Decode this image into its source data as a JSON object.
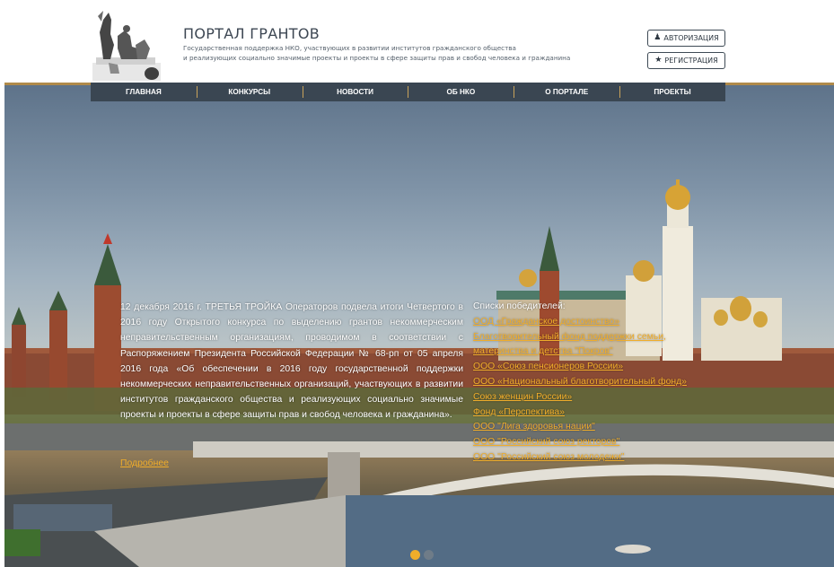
{
  "header": {
    "title": "ПОРТАЛ ГРАНТОВ",
    "subtitle_line1": "Государственная поддержка НКО, участвующих в развитии институтов гражданского общества",
    "subtitle_line2": "и реализующих социально значимые проекты и проекты в сфере защиты прав и свобод человека и гражданина",
    "login_label": "АВТОРИЗАЦИЯ",
    "register_label": "РЕГИСТРАЦИЯ",
    "login_icon": "user-icon",
    "register_icon": "star-icon"
  },
  "nav": {
    "items": [
      "ГЛАВНАЯ",
      "КОНКУРСЫ",
      "НОВОСТИ",
      "ОБ НКО",
      "О ПОРТАЛЕ",
      "ПРОЕКТЫ"
    ]
  },
  "slide": {
    "news_text": "12 декабря 2016 г. ТРЕТЬЯ ТРОЙКА Операторов подвела итоги Четвертого в 2016 году Открытого конкурса по выделению грантов некоммерческим неправительственным организациям, проводимом в соответствии с Распоряжением Президента Российской Федерации № 68-рп от 05 апреля 2016 года «Об обеспечении в 2016 году государственной поддержки некоммерческих неправительственных организаций, участвующих в развитии институтов гражданского общества и реализующих социально значимые проекты и проекты в сфере защиты прав и свобод человека и гражданина».",
    "more_label": "Подробнее",
    "winners_title": "Списки победителей:",
    "winners": [
      "ООД «Гражданское достоинство»",
      "Благотворительный фонд поддержки семьи, материнства и детства \"Покров\"",
      "ООО «Союз пенсионеров России»",
      "ООО «Национальный благотворительный фонд»",
      "Союз женщин России»",
      "Фонд «Перспектива»",
      "ООО \"Лига здоровья нации\"",
      "ООО \"Российский союз ректоров\"",
      "ООО \"Российский союз молодежи\""
    ]
  },
  "carousel": {
    "active_index": 0,
    "count": 2
  },
  "colors": {
    "nav_bg": "#3a4652",
    "accent": "#f0ad2a",
    "divider": "#c9a35a"
  }
}
